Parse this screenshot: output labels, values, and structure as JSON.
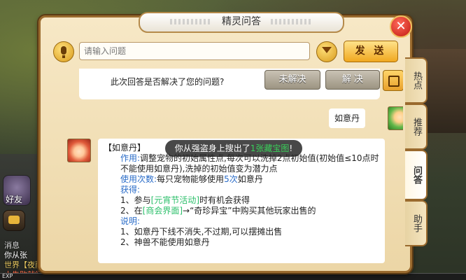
{
  "dialog": {
    "title": "精灵问答"
  },
  "toolbar": {
    "input_placeholder": "请输入问题",
    "send_label": "发 送"
  },
  "tabs": [
    "热点",
    "推荐",
    "问答",
    "助手"
  ],
  "feedback": {
    "question": "此次回答是否解决了您的问题?",
    "unsolved_label": "未解决",
    "solved_label": "解 决"
  },
  "user_message": {
    "text": "如意丹"
  },
  "answer": {
    "title": "【如意丹】",
    "effect_label": "作用:",
    "effect_text": "调整宠物的初始属性点,每次可以洗掉2点初始值(初始值≤10点时不能使用如意丹),洗掉的初始值变为潜力点",
    "uses_label": "使用次数:",
    "uses_text_prefix": "每只宠物能够使用",
    "uses_count": "5次",
    "uses_text_suffix": "如意丹",
    "obtain_label": "获得:",
    "obtain_1_prefix": "1、参与",
    "obtain_1_link": "[元宵节活动]",
    "obtain_1_suffix": "时有机会获得",
    "obtain_2_prefix": "2、在",
    "obtain_2_link": "[商会界面]",
    "obtain_2_suffix": "→“奇珍异宝”中购买其他玩家出售的",
    "note_label": "说明:",
    "note_1": "1、如意丹下线不消失,不过期,可以摆摊出售",
    "note_2": "2、神兽不能使用如意丹"
  },
  "toast": {
    "prefix": "你从强盗身上搜出了",
    "count": "1",
    "item": "张藏宝图",
    "suffix": "!"
  },
  "hud": {
    "friend_label": "好友",
    "log_1": "消息",
    "log_2": "你从张",
    "log_3": "世界【夜雨",
    "log_4": "小失败就行",
    "exp_label": "EXP"
  }
}
